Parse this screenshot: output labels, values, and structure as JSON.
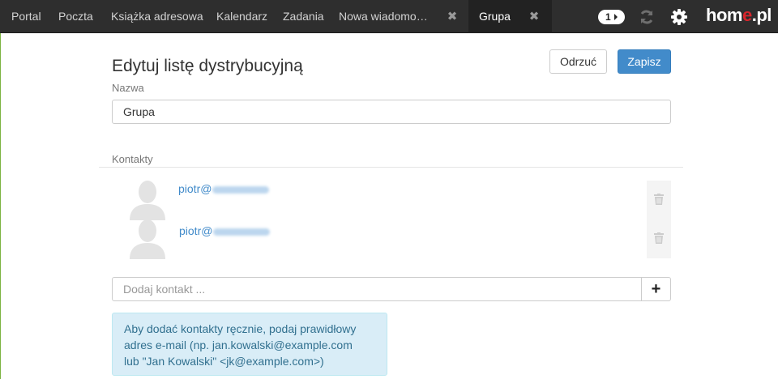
{
  "nav": {
    "items": [
      "Portal",
      "Poczta",
      "Książka adresowa",
      "Kalendarz",
      "Zadania"
    ],
    "tabs": [
      {
        "label": "Nowa wiadomo…"
      },
      {
        "label": "Grupa"
      }
    ],
    "badge": "1",
    "brand_left": "hom",
    "brand_dot": "e",
    "brand_right": ".pl"
  },
  "header": {
    "title": "Edytuj listę dystrybucyjną",
    "cancel_label": "Odrzuć",
    "save_label": "Zapisz"
  },
  "form": {
    "name_label": "Nazwa",
    "name_value": "Grupa",
    "contacts_label": "Kontakty",
    "contacts": [
      {
        "email_visible": "piotr@"
      },
      {
        "email_visible": "piotr@"
      }
    ],
    "add_placeholder": "Dodaj kontakt ...",
    "add_button_label": "+",
    "hint_lines": [
      "Aby dodać kontakty ręcznie, podaj prawidłowy",
      "adres e-mail (np. jan.kowalski@example.com",
      "lub \"Jan Kowalski\" <jk@example.com>)"
    ]
  },
  "colors": {
    "topbar": "#2e2e2e",
    "primary": "#428bca",
    "info_bg": "#d9edf7",
    "info_text": "#31708f",
    "brand_accent": "#d8262c"
  },
  "icons": [
    "close-icon",
    "refresh-icon",
    "gear-icon",
    "user-avatar-icon",
    "trash-icon",
    "plus-icon"
  ]
}
